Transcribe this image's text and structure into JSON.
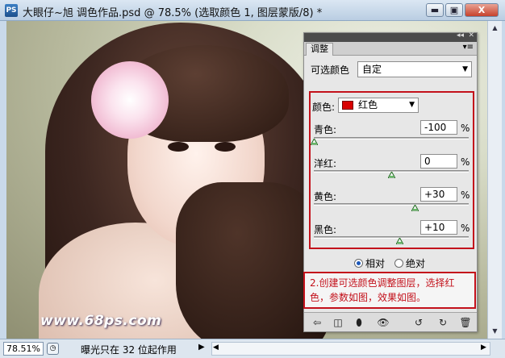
{
  "window": {
    "app_icon": "PS",
    "title": "大眼仔~旭 调色作品.psd @ 78.5% (选取颜色 1, 图层蒙版/8) *",
    "minimize": "▬",
    "maximize": "▣",
    "close": "X"
  },
  "canvas": {
    "watermark": "www.68ps.com"
  },
  "statusbar": {
    "zoom": "78.51%",
    "message": "曝光只在 32 位起作用",
    "arrow": "▶"
  },
  "panel": {
    "tab": "调整",
    "preset_label": "可选颜色",
    "preset_value": "自定",
    "colors_label": "颜色:",
    "colors_value": "红色",
    "swatch_color": "#d80000",
    "sliders": [
      {
        "label": "青色:",
        "value": "-100",
        "level": -100
      },
      {
        "label": "洋红:",
        "value": "0",
        "level": 0
      },
      {
        "label": "黄色:",
        "value": "+30",
        "level": 30
      },
      {
        "label": "黑色:",
        "value": "+10",
        "level": 10
      }
    ],
    "percent": "%",
    "method": {
      "relative": "相对",
      "absolute": "绝对",
      "selected": "relative"
    },
    "note": "2.创建可选颜色调整图层，选择红色，参数如图，效果如图。",
    "accent_color": "#c3111b",
    "bottom_icons": [
      "back-arrow-icon",
      "clip-layer-icon",
      "mask-icon",
      "visibility-eye-icon",
      "previous-state-icon",
      "reset-icon",
      "delete-trash-icon"
    ]
  }
}
